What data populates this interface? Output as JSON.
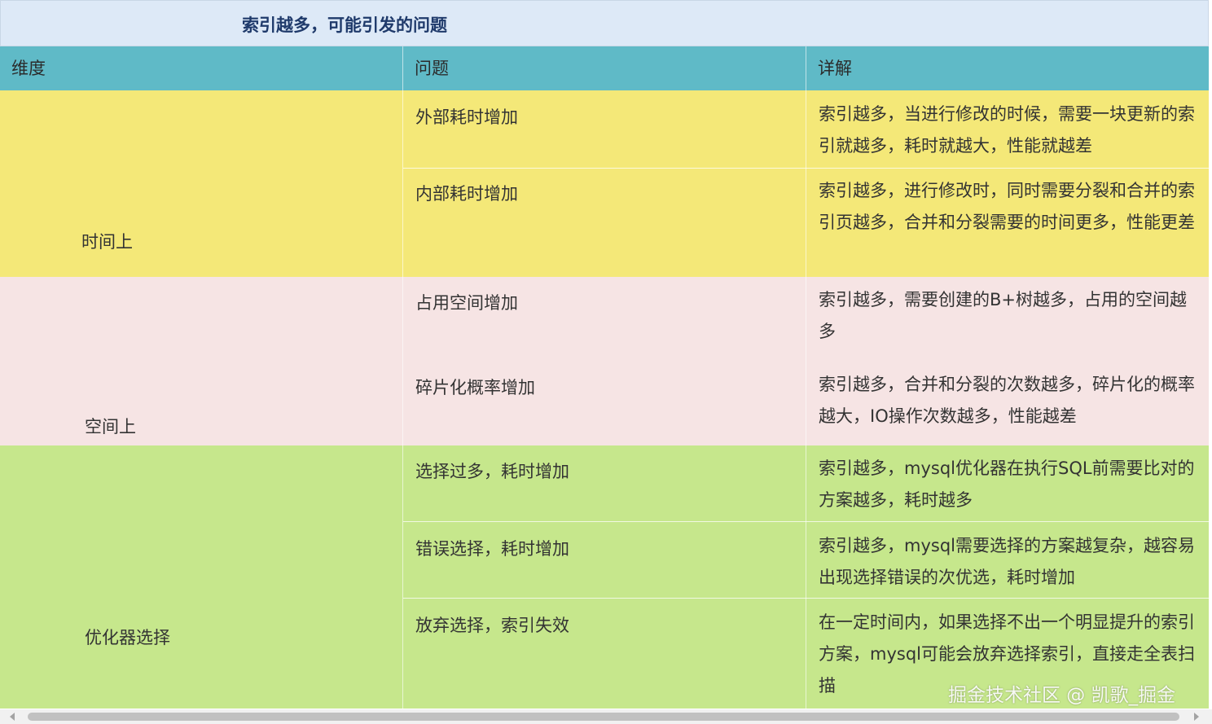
{
  "title": "索引越多，可能引发的问题",
  "columns": {
    "dimension": "维度",
    "problem": "问题",
    "detail": "详解"
  },
  "groups": [
    {
      "dimension": "时间上",
      "rows": [
        {
          "problem": "外部耗时增加",
          "detail": "索引越多，当进行修改的时候，需要一块更新的索引就越多，耗时就越大，性能就越差"
        },
        {
          "problem": "内部耗时增加",
          "detail": "索引越多，进行修改时，同时需要分裂和合并的索引页越多，合并和分裂需要的时间更多，性能更差"
        }
      ]
    },
    {
      "dimension": "空间上",
      "rows": [
        {
          "problem": "占用空间增加",
          "detail": "索引越多，需要创建的B+树越多，占用的空间越多"
        },
        {
          "problem": "碎片化概率增加",
          "detail": "索引越多，合并和分裂的次数越多，碎片化的概率越大，IO操作次数越多，性能越差"
        }
      ]
    },
    {
      "dimension": "优化器选择",
      "rows": [
        {
          "problem": "选择过多，耗时增加",
          "detail": "索引越多，mysql优化器在执行SQL前需要比对的方案越多，耗时越多"
        },
        {
          "problem": "错误选择，耗时增加",
          "detail": "索引越多，mysql需要选择的方案越复杂，越容易出现选择错误的次优选，耗时增加"
        },
        {
          "problem": "放弃选择，索引失效",
          "detail": "在一定时间内，如果选择不出一个明显提升的索引方案，mysql可能会放弃选择索引，直接走全表扫描"
        }
      ]
    }
  ],
  "watermark": "掘金技术社区 @ 凯歌_掘金",
  "colors": {
    "title_bg": "#dde9f7",
    "header_bg": "#5fbac7",
    "time_bg": "#f4e878",
    "space_bg": "#f6e4e4",
    "optimizer_bg": "#c6e78c"
  }
}
